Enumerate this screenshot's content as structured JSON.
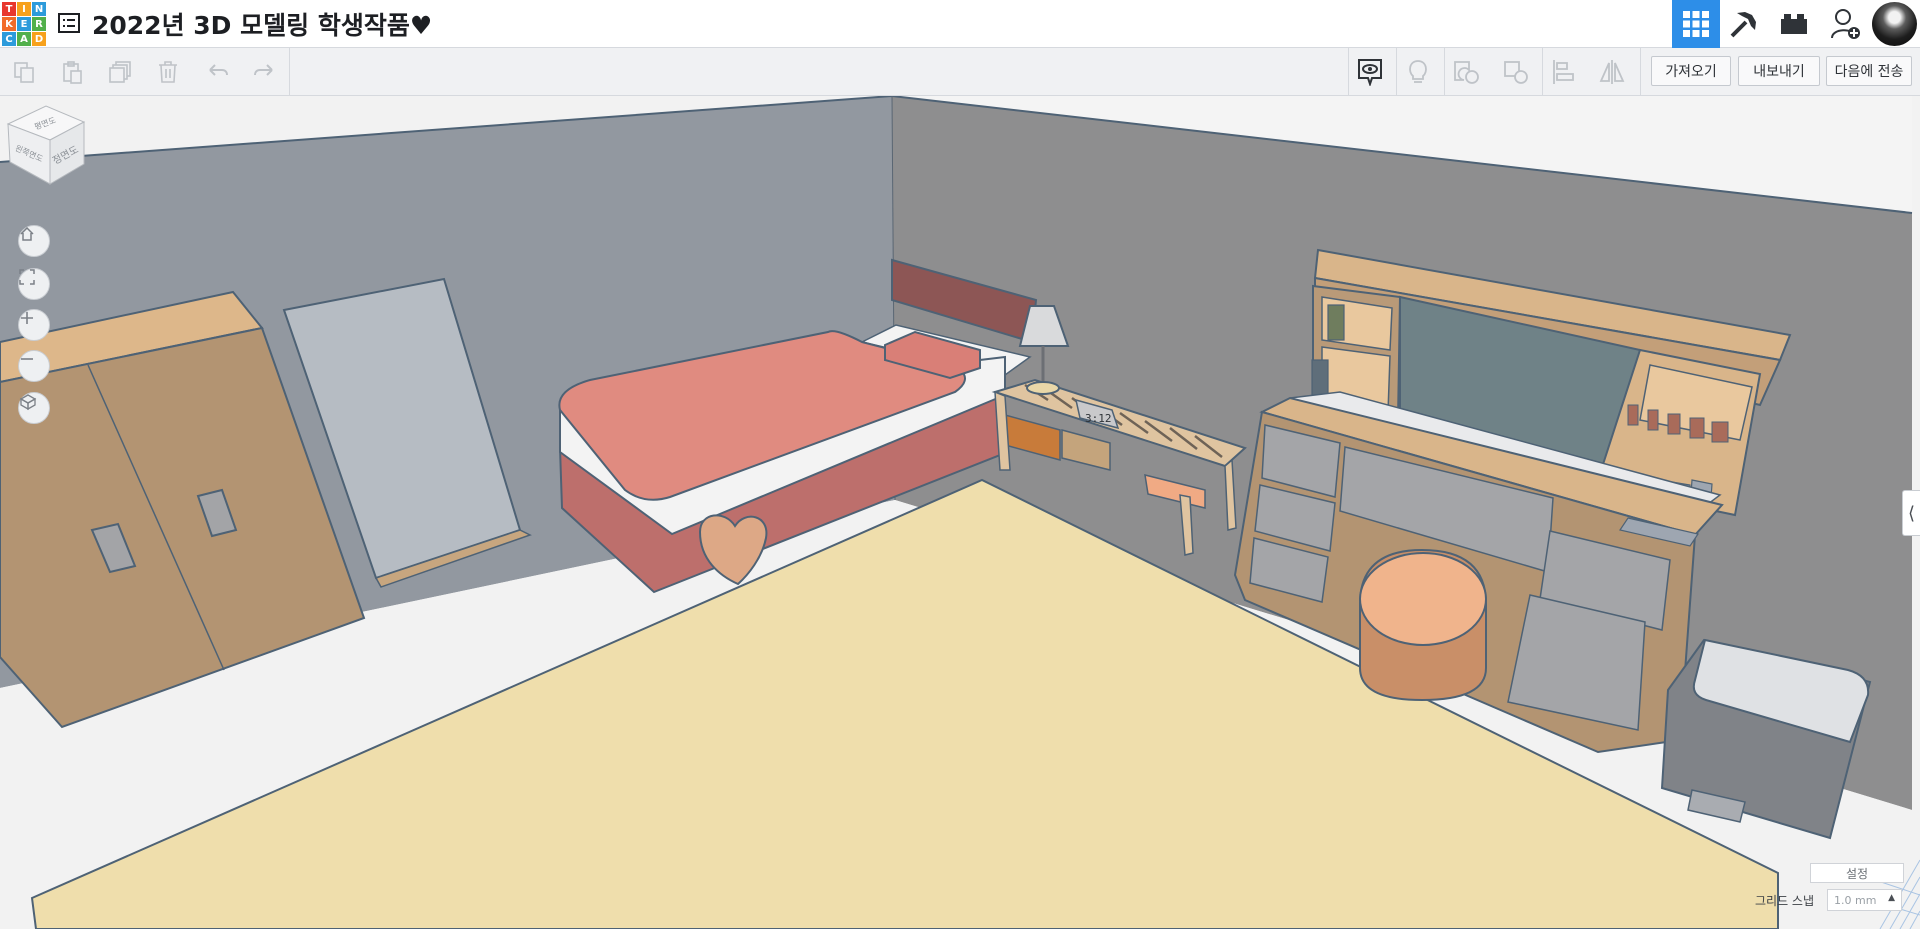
{
  "app": {
    "logo_letters": [
      "T",
      "I",
      "N",
      "K",
      "E",
      "R",
      "C",
      "A",
      "D"
    ],
    "logo_colors": [
      "#e8382e",
      "#f7a11c",
      "#2d9bdb",
      "#f26b29",
      "#2d9bdb",
      "#52b04b",
      "#2d9bdb",
      "#52b04b",
      "#f7a11c"
    ],
    "title": "2022년 3D 모델링 학생작품♥",
    "accent_color": "#2d8ee8"
  },
  "header": {
    "view_buttons": [
      {
        "icon": "3d-design-grid-icon",
        "active": true
      },
      {
        "icon": "minecraft-pickaxe-icon",
        "active": false
      },
      {
        "icon": "bricks-icon",
        "active": false
      },
      {
        "icon": "add-user-icon",
        "active": false
      }
    ],
    "avatar_icon": "user-avatar"
  },
  "toolbar": {
    "edit_tools": [
      "copy-icon",
      "paste-icon",
      "duplicate-icon",
      "delete-icon",
      "undo-icon",
      "redo-icon"
    ],
    "view_tools": [
      "notes-icon",
      "lightbulb-icon",
      "group-icon",
      "ungroup-icon",
      "align-icon",
      "mirror-icon"
    ],
    "import_label": "가져오기",
    "export_label": "내보내기",
    "send_label": "다음에 전송"
  },
  "workplane": {
    "viewcube": {
      "top_label": "평면도",
      "left_label": "왼쪽면도",
      "front_label": "정면도"
    },
    "nav_tools": [
      "home-icon",
      "fit-icon",
      "zoom-in-icon",
      "zoom-out-icon",
      "perspective-icon"
    ],
    "settings_label": "설정",
    "grid_snap_label": "그리드 스냅",
    "grid_snap_value": "1.0 mm",
    "clock_text": "3:12"
  }
}
